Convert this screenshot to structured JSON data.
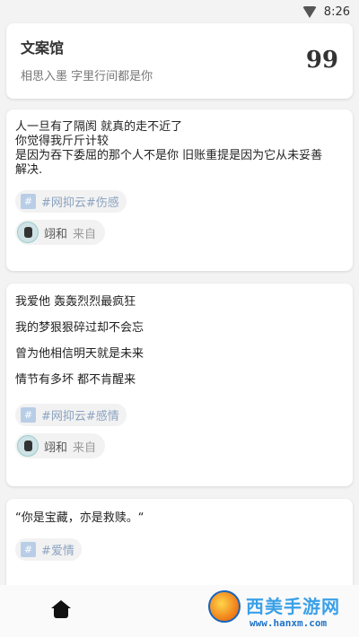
{
  "statusbar": {
    "time": "8:26"
  },
  "header": {
    "title": "文案馆",
    "subtitle": "相思入墨 字里行间都是你",
    "quote_icon": "99"
  },
  "cards": [
    {
      "lines": [
        "人一旦有了隔阂 就真的走不近了",
        "你觉得我斤斤计较",
        "是因为吞下委屈的那个人不是你 旧账重提是因为它从未妥善",
        "解决."
      ],
      "tag_hash": "#",
      "tag": "#网抑云#伤感",
      "author_name": "翊和",
      "author_from": "来自"
    },
    {
      "lines": [
        "我爱他 轰轰烈烈最疯狂",
        "我的梦狠狠碎过却不会忘",
        "曾为他相信明天就是未来",
        "情节有多坏 都不肯醒来"
      ],
      "tag_hash": "#",
      "tag": "#网抑云#感情",
      "author_name": "翊和",
      "author_from": "来自"
    },
    {
      "lines": [
        "“你是宝藏，亦是救赎。“"
      ],
      "tag_hash": "#",
      "tag": "#爱情"
    }
  ],
  "watermark": {
    "brand": "西美手游网",
    "url": "www.hanxm.com"
  },
  "icons": {
    "wifi": "wifi-icon",
    "home": "home-icon",
    "quote": "quote-icon"
  }
}
